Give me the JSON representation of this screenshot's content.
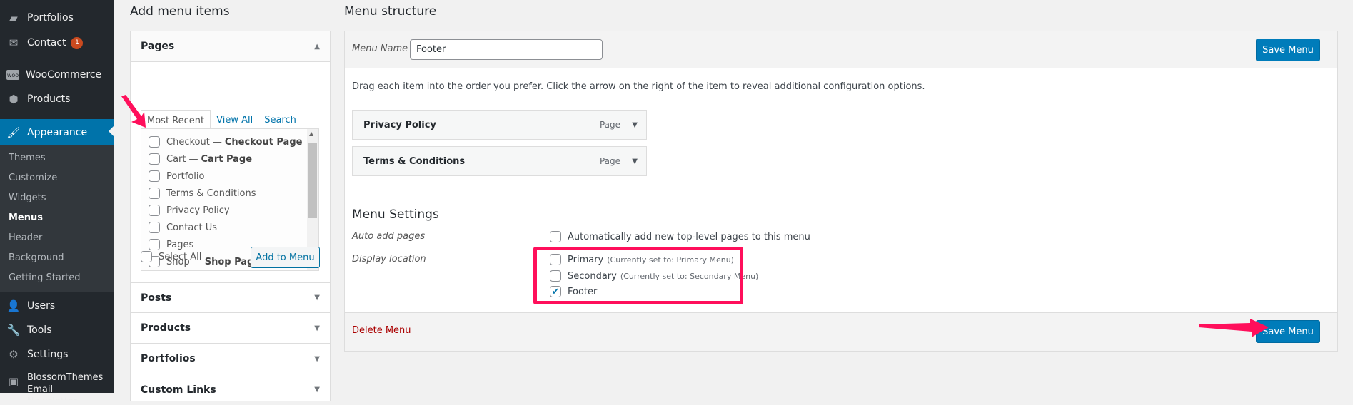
{
  "sidebar": {
    "items": [
      {
        "label": "Portfolios",
        "icon": "portfolio-icon"
      },
      {
        "label": "Contact",
        "icon": "mail-icon",
        "badge": "1"
      },
      {
        "label": "WooCommerce",
        "icon": "woocommerce-icon"
      },
      {
        "label": "Products",
        "icon": "products-icon"
      },
      {
        "label": "Appearance",
        "icon": "paintbrush-icon",
        "active": true
      },
      {
        "label": "Users",
        "icon": "users-icon"
      },
      {
        "label": "Tools",
        "icon": "wrench-icon"
      },
      {
        "label": "Settings",
        "icon": "settings-icon"
      },
      {
        "label": "BlossomThemes Email Newsletter",
        "icon": "newsletter-icon"
      }
    ],
    "submenu": [
      "Themes",
      "Customize",
      "Widgets",
      "Menus",
      "Header",
      "Background",
      "Getting Started"
    ],
    "submenu_current": "Menus"
  },
  "add_items": {
    "title": "Add menu items",
    "pages": {
      "label": "Pages",
      "tabs": [
        "Most Recent",
        "View All",
        "Search"
      ],
      "active_tab": "Most Recent",
      "items": [
        {
          "name": "Checkout",
          "suffix": "Checkout Page"
        },
        {
          "name": "Cart",
          "suffix": "Cart Page"
        },
        {
          "name": "Portfolio",
          "suffix": ""
        },
        {
          "name": "Terms & Conditions",
          "suffix": ""
        },
        {
          "name": "Privacy Policy",
          "suffix": ""
        },
        {
          "name": "Contact Us",
          "suffix": ""
        },
        {
          "name": "Pages",
          "suffix": ""
        },
        {
          "name": "Shop",
          "suffix": "Shop Page"
        }
      ],
      "dash": "—",
      "select_all": "Select All",
      "add_button": "Add to Menu"
    },
    "sections": [
      "Posts",
      "Products",
      "Portfolios",
      "Custom Links"
    ]
  },
  "structure": {
    "title": "Menu structure",
    "menu_name_label": "Menu Name",
    "menu_name_value": "Footer",
    "save_label": "Save Menu",
    "instructions": "Drag each item into the order you prefer. Click the arrow on the right of the item to reveal additional configuration options.",
    "menu_items": [
      {
        "title": "Privacy Policy",
        "type": "Page"
      },
      {
        "title": "Terms & Conditions",
        "type": "Page"
      }
    ],
    "settings": {
      "title": "Menu Settings",
      "auto_add_label": "Auto add pages",
      "auto_add_text": "Automatically add new top-level pages to this menu",
      "auto_add_checked": false,
      "display_location_label": "Display location",
      "locations": [
        {
          "name": "Primary",
          "note": "(Currently set to: Primary Menu)",
          "checked": false
        },
        {
          "name": "Secondary",
          "note": "(Currently set to: Secondary Menu)",
          "checked": false
        },
        {
          "name": "Footer",
          "note": "",
          "checked": true
        }
      ]
    },
    "delete_label": "Delete Menu"
  },
  "colors": {
    "accent": "#0073aa",
    "annotation": "#ff0f5b",
    "delete": "#a00"
  }
}
